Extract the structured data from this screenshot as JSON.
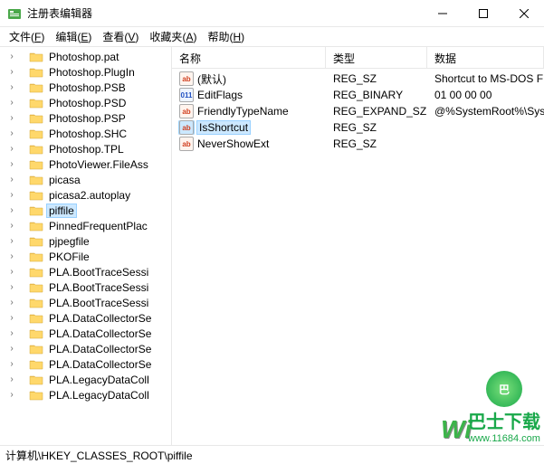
{
  "title": "注册表编辑器",
  "menus": [
    {
      "label": "文件",
      "accel": "F"
    },
    {
      "label": "编辑",
      "accel": "E"
    },
    {
      "label": "查看",
      "accel": "V"
    },
    {
      "label": "收藏夹",
      "accel": "A"
    },
    {
      "label": "帮助",
      "accel": "H"
    }
  ],
  "tree": [
    {
      "label": "Photoshop.pat",
      "sel": false
    },
    {
      "label": "Photoshop.PlugIn",
      "sel": false
    },
    {
      "label": "Photoshop.PSB",
      "sel": false
    },
    {
      "label": "Photoshop.PSD",
      "sel": false
    },
    {
      "label": "Photoshop.PSP",
      "sel": false
    },
    {
      "label": "Photoshop.SHC",
      "sel": false
    },
    {
      "label": "Photoshop.TPL",
      "sel": false
    },
    {
      "label": "PhotoViewer.FileAss",
      "sel": false
    },
    {
      "label": "picasa",
      "sel": false
    },
    {
      "label": "picasa2.autoplay",
      "sel": false
    },
    {
      "label": "piffile",
      "sel": true
    },
    {
      "label": "PinnedFrequentPlac",
      "sel": false
    },
    {
      "label": "pjpegfile",
      "sel": false
    },
    {
      "label": "PKOFile",
      "sel": false
    },
    {
      "label": "PLA.BootTraceSessi",
      "sel": false
    },
    {
      "label": "PLA.BootTraceSessi",
      "sel": false
    },
    {
      "label": "PLA.BootTraceSessi",
      "sel": false
    },
    {
      "label": "PLA.DataCollectorSe",
      "sel": false
    },
    {
      "label": "PLA.DataCollectorSe",
      "sel": false
    },
    {
      "label": "PLA.DataCollectorSe",
      "sel": false
    },
    {
      "label": "PLA.DataCollectorSe",
      "sel": false
    },
    {
      "label": "PLA.LegacyDataColl",
      "sel": false
    },
    {
      "label": "PLA.LegacyDataColl",
      "sel": false
    }
  ],
  "columns": {
    "name": "名称",
    "type": "类型",
    "data": "数据"
  },
  "values": [
    {
      "name": "(默认)",
      "type": "REG_SZ",
      "data": "Shortcut to MS-DOS F",
      "icon": "str",
      "sel": false
    },
    {
      "name": "EditFlags",
      "type": "REG_BINARY",
      "data": "01 00 00 00",
      "icon": "bin",
      "sel": false
    },
    {
      "name": "FriendlyTypeName",
      "type": "REG_EXPAND_SZ",
      "data": "@%SystemRoot%\\Sys",
      "icon": "str",
      "sel": false
    },
    {
      "name": "IsShortcut",
      "type": "REG_SZ",
      "data": "",
      "icon": "str",
      "sel": true
    },
    {
      "name": "NeverShowExt",
      "type": "REG_SZ",
      "data": "",
      "icon": "str",
      "sel": false
    }
  ],
  "status": "计算机\\HKEY_CLASSES_ROOT\\piffile",
  "watermark": {
    "w": "Wi",
    "brand": "巴士下载",
    "url": "www.11684.com"
  }
}
